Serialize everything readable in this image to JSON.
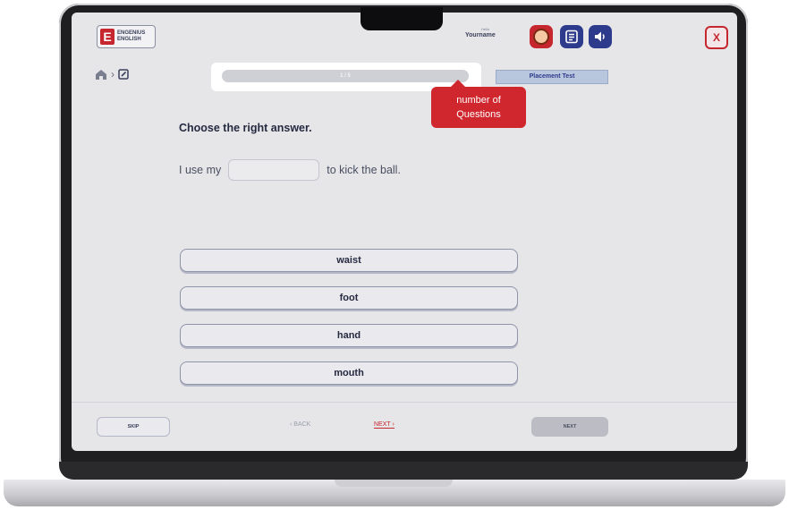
{
  "header": {
    "logo_line1": "ENGENIUS",
    "logo_line2": "ENGLISH",
    "logo_letter": "E",
    "username_small": "Hello",
    "username": "Yourname",
    "close_label": "X",
    "icons": [
      "avatar-icon",
      "notes-icon",
      "speaker-icon",
      "close-icon"
    ]
  },
  "nav": {
    "breadcrumb_separator": "›",
    "icons": [
      "home-icon",
      "edit-icon"
    ]
  },
  "progress": {
    "label": "1 / 5",
    "fraction_filled": 0
  },
  "badge": {
    "label": "Placement Test"
  },
  "tooltip": {
    "line1": "number of",
    "line2": "Questions"
  },
  "question": {
    "prompt": "Choose the right answer.",
    "before_blank": "I use my",
    "after_blank": "to kick the ball."
  },
  "options": [
    "waist",
    "foot",
    "hand",
    "mouth"
  ],
  "footer": {
    "skip_label": "SKIP",
    "back_label": "‹ BACK",
    "next_link_label": "NEXT ›",
    "next_button_label": "NEXT"
  },
  "colors": {
    "brand_red": "#c6262e",
    "brand_navy": "#2e3a8c",
    "screen_bg": "#e6e6e9"
  }
}
